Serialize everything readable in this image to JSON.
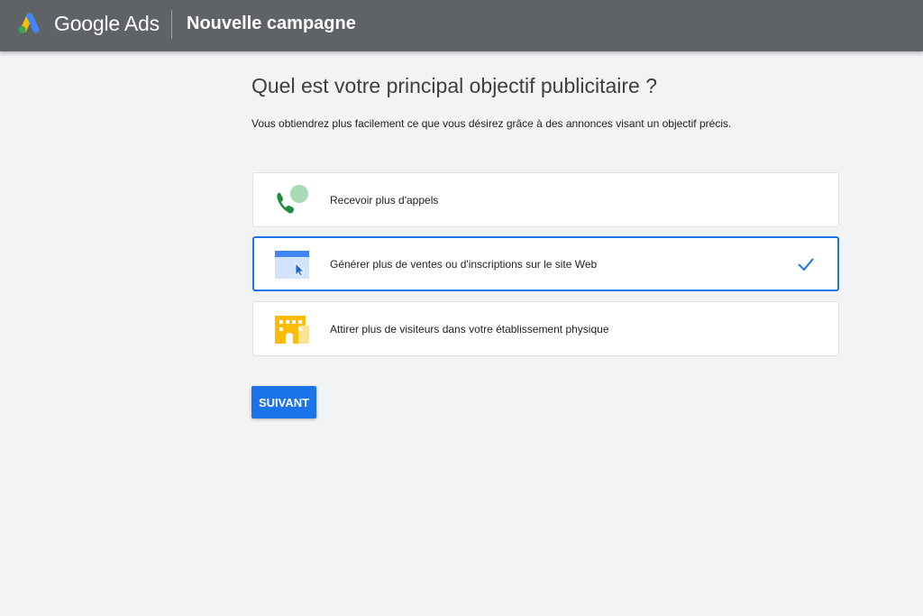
{
  "header": {
    "brand": "Google Ads",
    "page_title": "Nouvelle campagne",
    "logo_icon": "google-ads-logo-icon"
  },
  "main": {
    "title": "Quel est votre principal objectif publicitaire ?",
    "subtitle": "Vous obtiendrez plus facilement ce que vous désirez grâce à des annonces visant un objectif précis.",
    "options": [
      {
        "label": "Recevoir plus d'appels",
        "icon": "phone-call-icon",
        "selected": false
      },
      {
        "label": "Générer plus de ventes ou d'inscriptions sur le site Web",
        "icon": "website-cursor-icon",
        "selected": true
      },
      {
        "label": "Attirer plus de visiteurs dans votre établissement physique",
        "icon": "store-building-icon",
        "selected": false
      }
    ],
    "next_button": "SUIVANT"
  },
  "colors": {
    "header_bg": "#5f6368",
    "page_bg": "#f1f3f4",
    "accent": "#1a73e8"
  }
}
